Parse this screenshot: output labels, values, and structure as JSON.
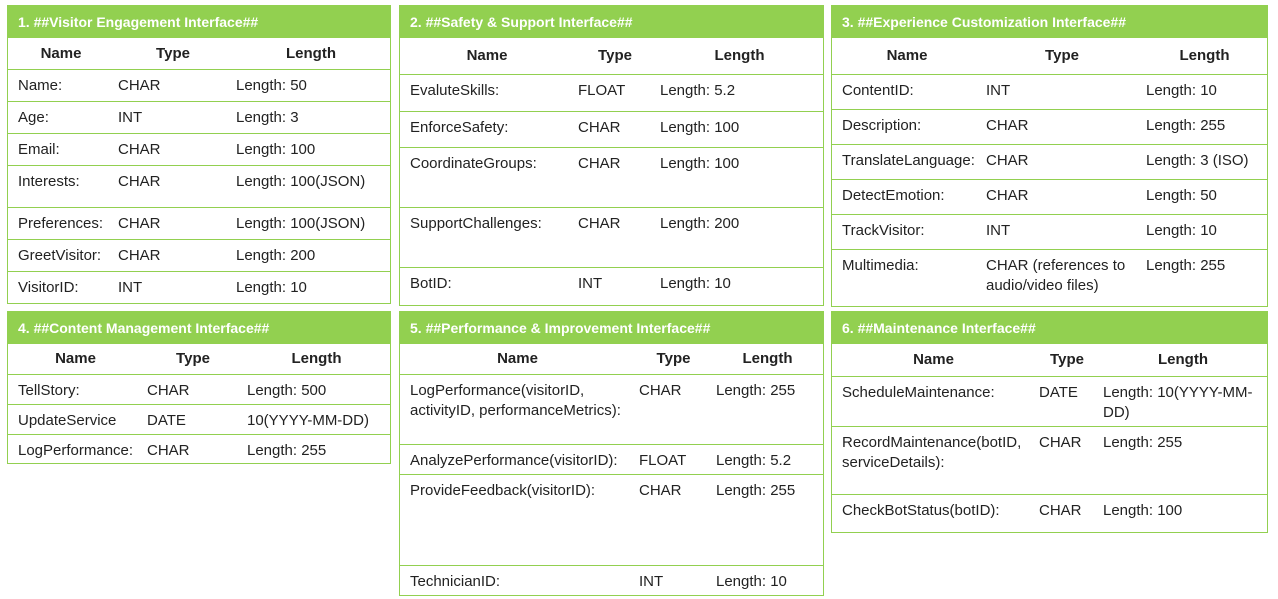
{
  "columns": {
    "name": "Name",
    "type": "Type",
    "length": "Length"
  },
  "panels": [
    {
      "title": "1. ##Visitor Engagement Interface##",
      "rows": [
        {
          "name": "Name:",
          "type": "CHAR",
          "length": "Length: 50"
        },
        {
          "name": "Age:",
          "type": "INT",
          "length": "Length: 3"
        },
        {
          "name": "Email:",
          "type": "CHAR",
          "length": "Length: 100"
        },
        {
          "name": "Interests:",
          "type": "CHAR",
          "length": "Length: 100(JSON)"
        },
        {
          "name": "Preferences:",
          "type": "CHAR",
          "length": "Length: 100(JSON)"
        },
        {
          "name": "GreetVisitor:",
          "type": "CHAR",
          "length": "Length: 200"
        },
        {
          "name": "VisitorID:",
          "type": "INT",
          "length": "Length: 10"
        }
      ]
    },
    {
      "title": "2. ##Safety & Support Interface##",
      "rows": [
        {
          "name": "EvaluteSkills:",
          "type": "FLOAT",
          "length": "Length: 5.2"
        },
        {
          "name": "EnforceSafety:",
          "type": "CHAR",
          "length": "Length: 100"
        },
        {
          "name": "CoordinateGroups:",
          "type": "CHAR",
          "length": "Length: 100"
        },
        {
          "name": "SupportChallenges:",
          "type": "CHAR",
          "length": "Length: 200"
        },
        {
          "name": "BotID:",
          "type": "INT",
          "length": "Length: 10"
        }
      ]
    },
    {
      "title": "3. ##Experience Customization Interface##",
      "rows": [
        {
          "name": "ContentID:",
          "type": "INT",
          "length": "Length: 10"
        },
        {
          "name": "Description:",
          "type": "CHAR",
          "length": "Length: 255"
        },
        {
          "name": "TranslateLanguage:",
          "type": "CHAR",
          "length": "Length: 3 (ISO)"
        },
        {
          "name": "DetectEmotion:",
          "type": "CHAR",
          "length": "Length: 50"
        },
        {
          "name": "TrackVisitor:",
          "type": "INT",
          "length": "Length: 10"
        },
        {
          "name": "Multimedia:",
          "type": "CHAR (references to audio/video files)",
          "length": "Length: 255"
        }
      ]
    },
    {
      "title": "4. ##Content Management Interface##",
      "rows": [
        {
          "name": "TellStory:",
          "type": "CHAR",
          "length": "Length: 500"
        },
        {
          "name": "UpdateService",
          "type": "DATE",
          "length": "10(YYYY-MM-DD)"
        },
        {
          "name": "LogPerformance:",
          "type": "CHAR",
          "length": "Length: 255"
        }
      ]
    },
    {
      "title": "5. ##Performance & Improvement Interface##",
      "rows": [
        {
          "name": "LogPerformance(visitorID, activityID, performanceMetrics):",
          "type": "CHAR",
          "length": "Length: 255"
        },
        {
          "name": "AnalyzePerformance(visitorID):",
          "type": "FLOAT",
          "length": "Length: 5.2"
        },
        {
          "name": "ProvideFeedback(visitorID):",
          "type": "CHAR",
          "length": "Length: 255"
        },
        {
          "name": "TechnicianID:",
          "type": "INT",
          "length": "Length: 10"
        }
      ]
    },
    {
      "title": "6. ##Maintenance Interface##",
      "rows": [
        {
          "name": "ScheduleMaintenance:",
          "type": "DATE",
          "length": "Length: 10(YYYY-MM-DD)"
        },
        {
          "name": "RecordMaintenance(botID, serviceDetails):",
          "type": "CHAR",
          "length": "Length: 255"
        },
        {
          "name": "CheckBotStatus(botID):",
          "type": "CHAR",
          "length": "Length: 100"
        }
      ]
    }
  ]
}
